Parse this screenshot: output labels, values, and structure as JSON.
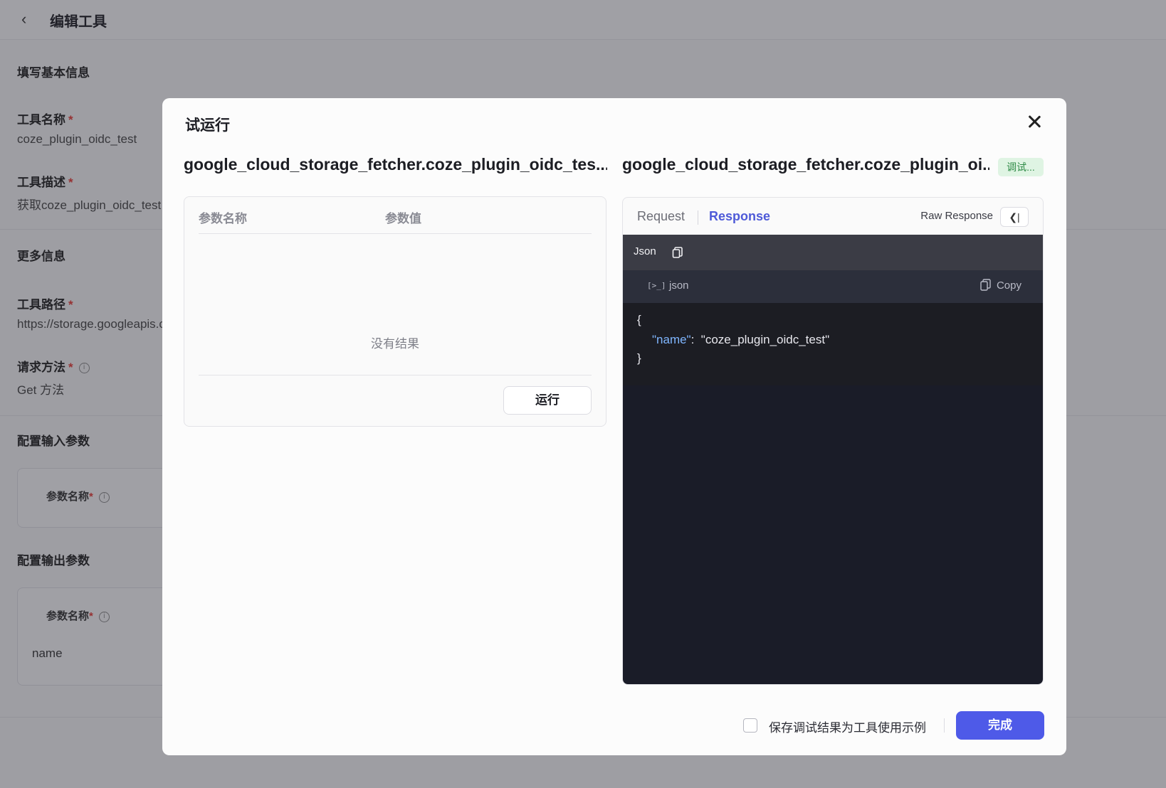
{
  "background": {
    "header_title": "编辑工具",
    "section_basic": "填写基本信息",
    "tool_name_label": "工具名称",
    "tool_name_value": "coze_plugin_oidc_test",
    "tool_desc_label": "工具描述",
    "tool_desc_value": "获取coze_plugin_oidc_test",
    "section_more": "更多信息",
    "tool_path_label": "工具路径",
    "tool_path_value": "https://storage.googleapis.com",
    "method_label": "请求方法",
    "method_value": "Get 方法",
    "section_input": "配置输入参数",
    "input_param_label": "参数名称",
    "section_output": "配置输出参数",
    "output_param_label": "参数名称",
    "output_param_value": "name",
    "required_mark": "*",
    "info_glyph": "i"
  },
  "modal": {
    "title": "试运行",
    "left_title": "google_cloud_storage_fetcher.coze_plugin_oidc_tes...",
    "right_title": "google_cloud_storage_fetcher.coze_plugin_oi...",
    "status_badge": "调试...",
    "params": {
      "col_name": "参数名称",
      "col_value": "参数值",
      "empty": "没有结果",
      "run_label": "运行"
    },
    "tabs": {
      "request": "Request",
      "response": "Response",
      "raw_response": "Raw Response",
      "collapse_glyph": "❮|"
    },
    "json_bar": {
      "label": "Json",
      "copy_icon": "copy-icon"
    },
    "code": {
      "lang": "json",
      "terminal_glyph": "[>_]",
      "copy_label": "Copy",
      "open_brace": "{",
      "key": "\"name\"",
      "colon": ":",
      "value": "\"coze_plugin_oidc_test\"",
      "close_brace": "}"
    },
    "footer": {
      "save_example_label": "保存调试结果为工具使用示例",
      "done_label": "完成"
    }
  },
  "colors": {
    "accent": "#4e5ae8",
    "badge_bg": "#dff4e3",
    "badge_text": "#2d8a45",
    "json_key": "#7fb6ff",
    "code_bg": "#1a1c28"
  }
}
